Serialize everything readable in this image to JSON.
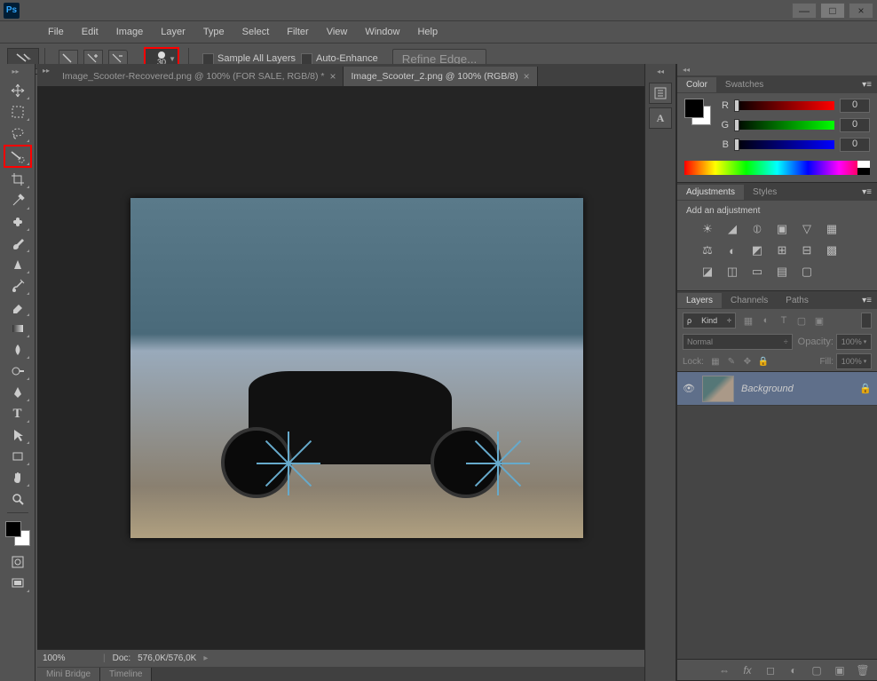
{
  "app": {
    "logo": "Ps"
  },
  "window_controls": {
    "minimize": "—",
    "maximize": "□",
    "close": "×"
  },
  "menu": [
    "File",
    "Edit",
    "Image",
    "Layer",
    "Type",
    "Select",
    "Filter",
    "View",
    "Window",
    "Help"
  ],
  "options_bar": {
    "brush_size": "30",
    "sample_all_layers": "Sample All Layers",
    "auto_enhance": "Auto-Enhance",
    "refine_edge": "Refine Edge..."
  },
  "tabs": [
    {
      "label": "Image_Scooter-Recovered.png @ 100% (FOR SALE, RGB/8) *",
      "active": false
    },
    {
      "label": "Image_Scooter_2.png @ 100% (RGB/8)",
      "active": true
    }
  ],
  "status": {
    "zoom": "100%",
    "doc_label": "Doc:",
    "doc_value": "576,0K/576,0K"
  },
  "bottom_tabs": [
    "Mini Bridge",
    "Timeline"
  ],
  "panels": {
    "color": {
      "tab_color": "Color",
      "tab_swatches": "Swatches",
      "channels": [
        {
          "label": "R",
          "value": "0"
        },
        {
          "label": "G",
          "value": "0"
        },
        {
          "label": "B",
          "value": "0"
        }
      ]
    },
    "adjustments": {
      "tab_adj": "Adjustments",
      "tab_styles": "Styles",
      "add_label": "Add an adjustment"
    },
    "layers": {
      "tab_layers": "Layers",
      "tab_channels": "Channels",
      "tab_paths": "Paths",
      "kind": "Kind",
      "blend_mode": "Normal",
      "opacity_label": "Opacity:",
      "opacity_value": "100%",
      "lock_label": "Lock:",
      "fill_label": "Fill:",
      "fill_value": "100%",
      "layer_name": "Background"
    }
  },
  "dock_icons": [
    "history",
    "text-panel"
  ],
  "tools": [
    "move",
    "rect-marquee",
    "lasso",
    "quick-selection",
    "crop",
    "eyedropper",
    "healing",
    "brush",
    "clone",
    "history-brush",
    "eraser",
    "gradient",
    "blur",
    "dodge",
    "pen",
    "type",
    "path-select",
    "rectangle",
    "hand",
    "zoom"
  ],
  "highlighted_tool_index": 3,
  "highlighted_option": "brush-size"
}
